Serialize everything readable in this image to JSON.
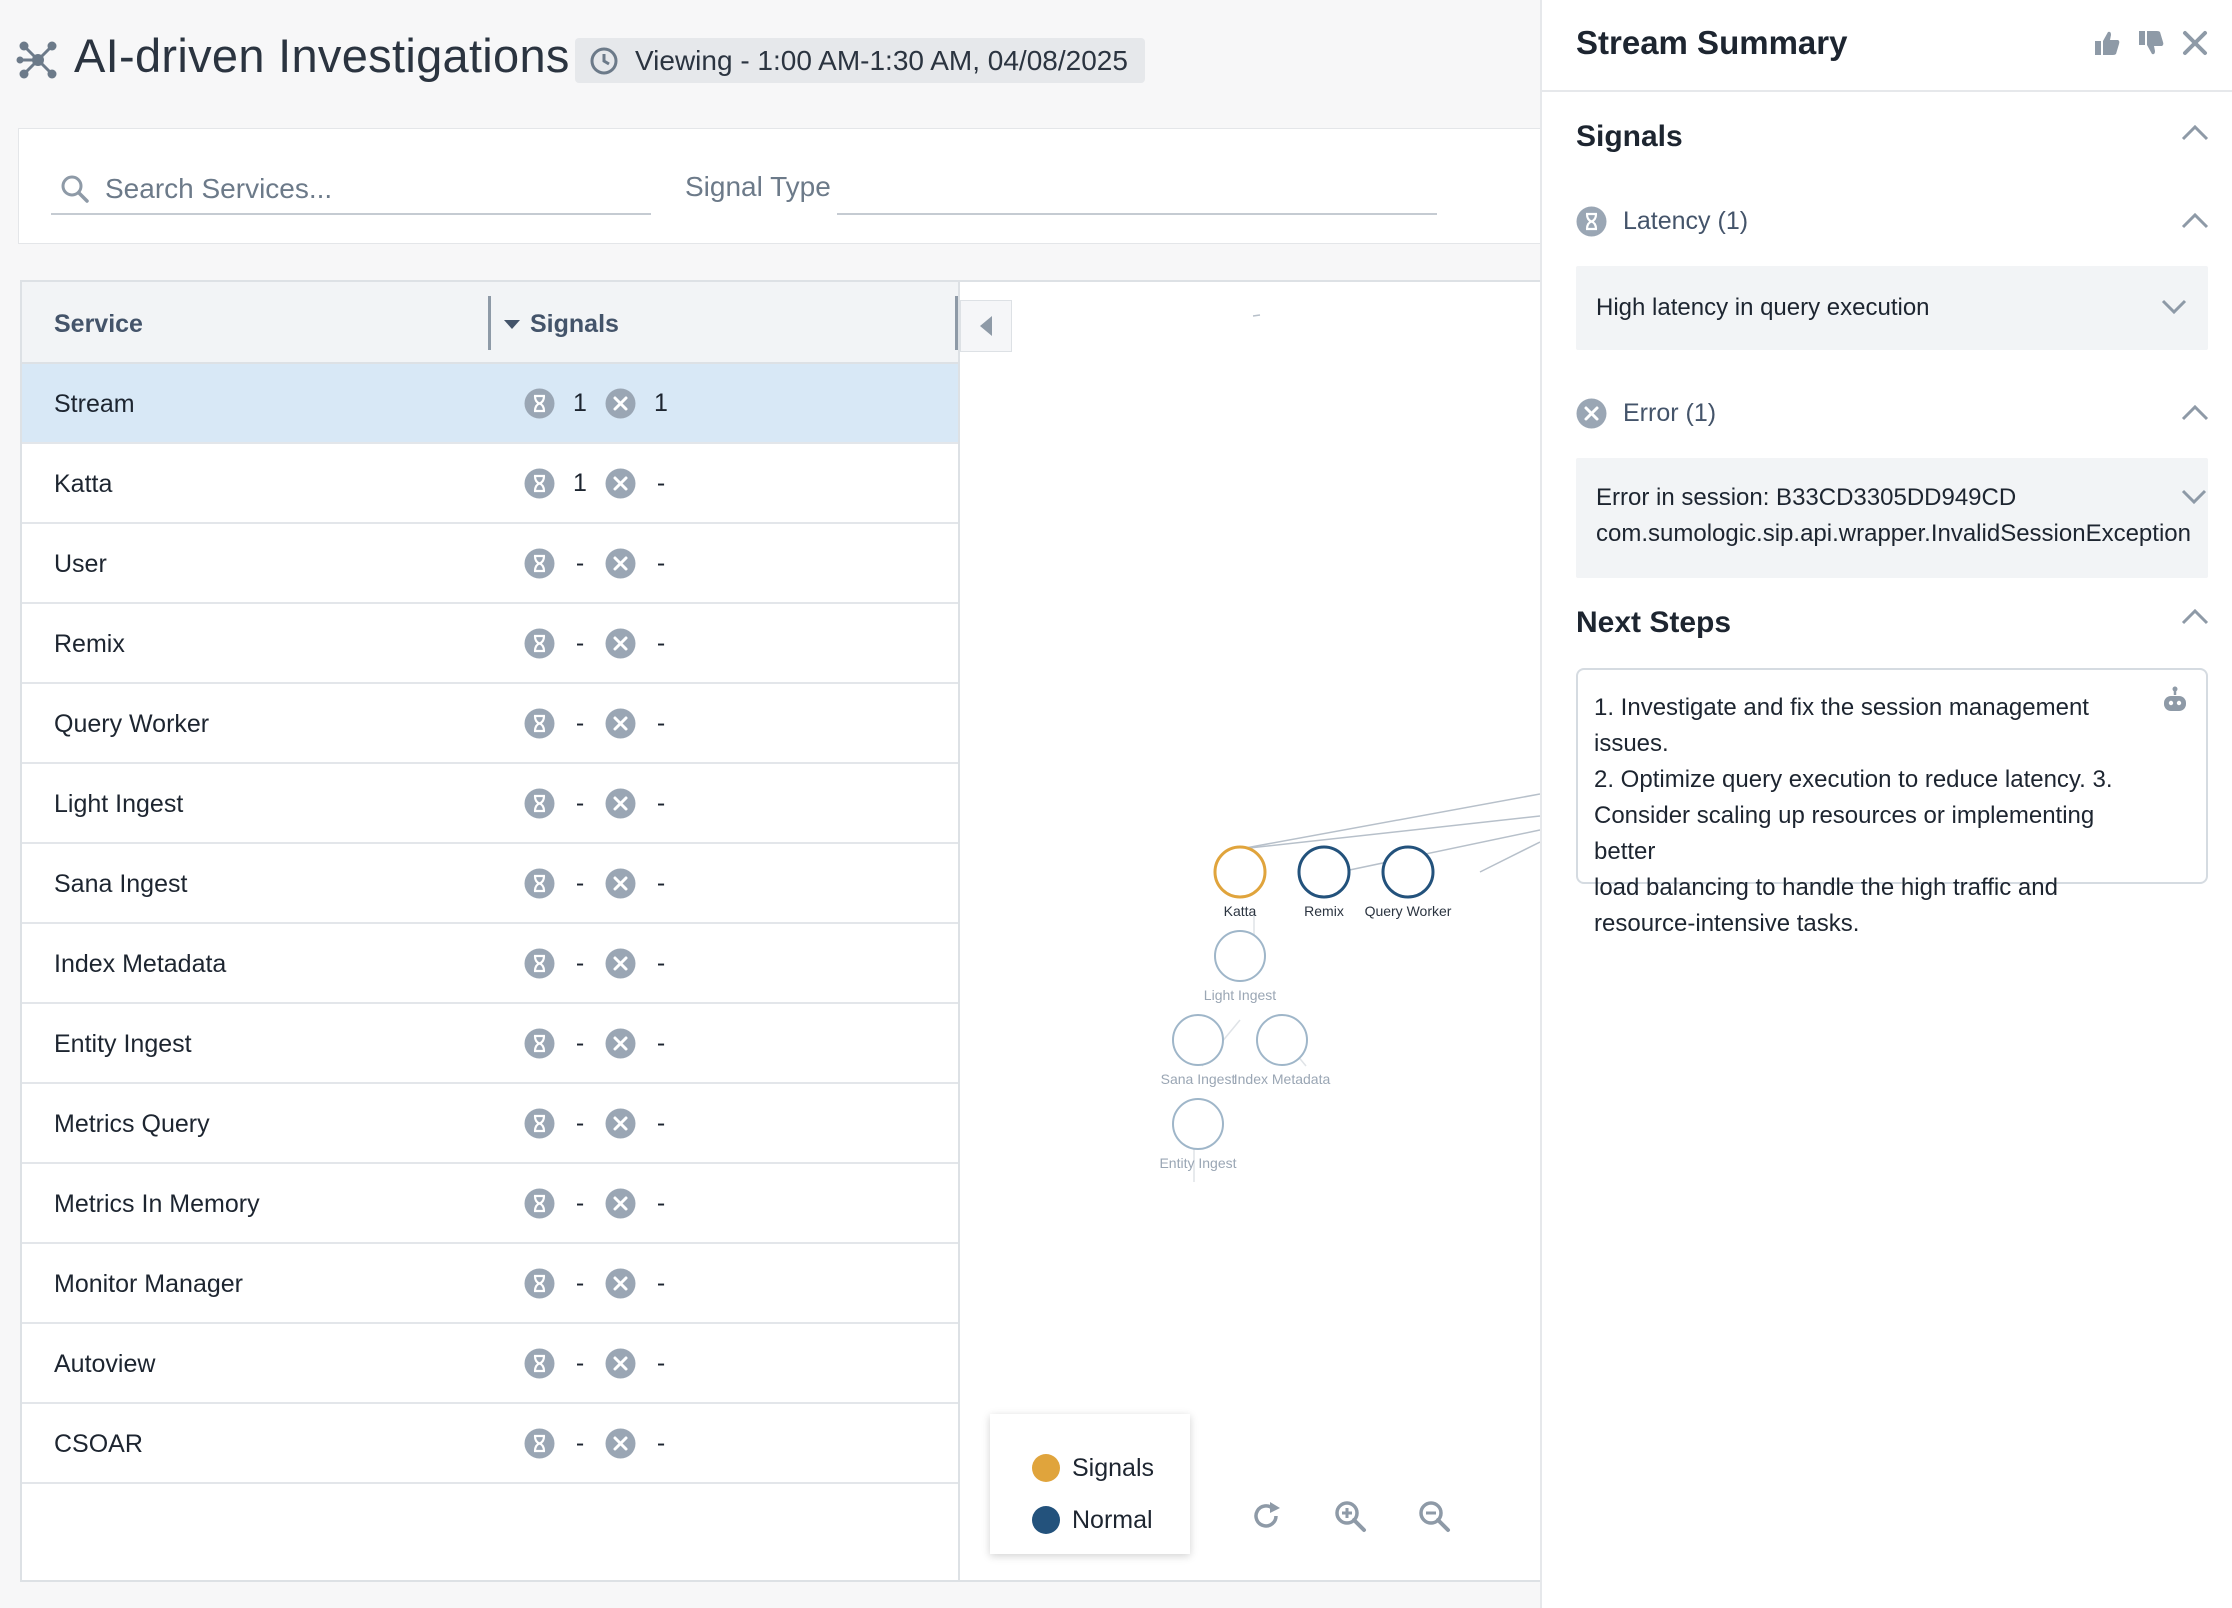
{
  "header": {
    "title": "AI-driven Investigations",
    "time_range": "Viewing - 1:00 AM-1:30 AM, 04/08/2025"
  },
  "filters": {
    "search_placeholder": "Search Services...",
    "signal_type_label": "Signal Type"
  },
  "table": {
    "columns": [
      "Service",
      "Signals"
    ],
    "rows": [
      {
        "name": "Stream",
        "latency": "1",
        "error": "1"
      },
      {
        "name": "Katta",
        "latency": "1",
        "error": "-"
      },
      {
        "name": "User",
        "latency": "-",
        "error": "-"
      },
      {
        "name": "Remix",
        "latency": "-",
        "error": "-"
      },
      {
        "name": "Query Worker",
        "latency": "-",
        "error": "-"
      },
      {
        "name": "Light Ingest",
        "latency": "-",
        "error": "-"
      },
      {
        "name": "Sana Ingest",
        "latency": "-",
        "error": "-"
      },
      {
        "name": "Index Metadata",
        "latency": "-",
        "error": "-"
      },
      {
        "name": "Entity Ingest",
        "latency": "-",
        "error": "-"
      },
      {
        "name": "Metrics Query",
        "latency": "-",
        "error": "-"
      },
      {
        "name": "Metrics In Memory",
        "latency": "-",
        "error": "-"
      },
      {
        "name": "Monitor Manager",
        "latency": "-",
        "error": "-"
      },
      {
        "name": "Autoview",
        "latency": "-",
        "error": "-"
      },
      {
        "name": "CSOAR",
        "latency": "-",
        "error": "-"
      }
    ]
  },
  "graph": {
    "nodes": [
      {
        "label": "Katta",
        "status": "signals"
      },
      {
        "label": "Remix",
        "status": "normal"
      },
      {
        "label": "Query Worker",
        "status": "normal"
      },
      {
        "label": "Light Ingest",
        "status": "faded"
      },
      {
        "label": "Sana Ingest",
        "status": "faded"
      },
      {
        "label": "Index Metadata",
        "status": "faded"
      },
      {
        "label": "Entity Ingest",
        "status": "faded"
      }
    ],
    "legend": [
      {
        "label": "Signals",
        "color": "#e0a43c"
      },
      {
        "label": "Normal",
        "color": "#23527c"
      }
    ],
    "controls": [
      "refresh-icon",
      "zoom-in-icon",
      "zoom-out-icon"
    ]
  },
  "panel": {
    "title": "Stream Summary",
    "signals_title": "Signals",
    "latency_label": "Latency (1)",
    "latency_item": "High latency in query execution",
    "error_label": "Error (1)",
    "error_item_line1": "Error in session: B33CD3305DD949CD",
    "error_item_line2": "com.sumologic.sip.api.wrapper.InvalidSessionException",
    "next_steps_title": "Next Steps",
    "next_steps_lines": [
      "1. Investigate and fix the session management issues.",
      "2. Optimize query execution to reduce latency. 3.",
      "Consider scaling up resources or implementing better",
      "load balancing to handle the high traffic and",
      "resource-intensive tasks."
    ]
  },
  "colors": {
    "accent": "#23527c",
    "signals": "#e0a43c",
    "selected_row": "#d8e8f6",
    "icon_grey": "#9aa6b4"
  }
}
